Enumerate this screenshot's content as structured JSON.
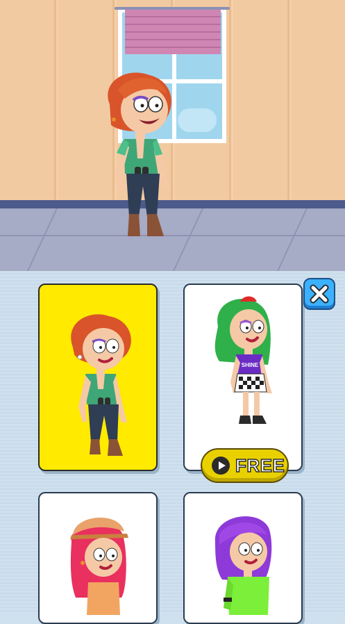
{
  "scene": {
    "character": "redhead-green-top-binoculars"
  },
  "outfits": [
    {
      "name": "redhead-green-top",
      "selected": true,
      "locked": false
    },
    {
      "name": "green-hair-shine-top",
      "selected": false,
      "locked": true,
      "shirt_text": "SHINE"
    },
    {
      "name": "pink-hair-cap",
      "selected": false,
      "locked": false
    },
    {
      "name": "purple-hair-green-top",
      "selected": false,
      "locked": false
    }
  ],
  "free_button": {
    "label": "FREE"
  },
  "colors": {
    "selected_card": "#ffea00",
    "close_button": "#3bb1ff",
    "free_button": "#e9d100"
  }
}
